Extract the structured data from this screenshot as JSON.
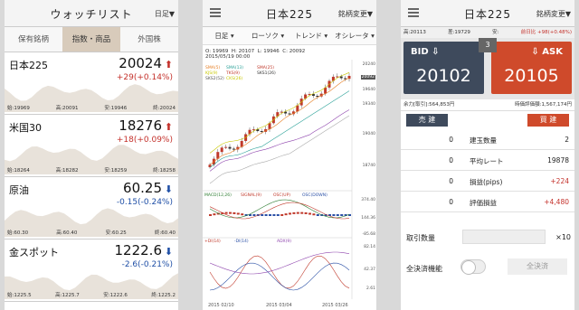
{
  "watchlist": {
    "title": "ウォッチリスト",
    "sort_label": "日足",
    "tabs": [
      "保有銘柄",
      "指数・商品",
      "外国株"
    ],
    "items": [
      {
        "name": "日本225",
        "price": "20024",
        "change": "+29(+0.14%)",
        "dir": "up",
        "open": "始:19969",
        "high": "高:20091",
        "low": "安:19946",
        "close": "終:20024"
      },
      {
        "name": "米国30",
        "price": "18276",
        "change": "+18(+0.09%)",
        "dir": "up",
        "open": "始:18264",
        "high": "高:18282",
        "low": "安:18259",
        "close": "終:18258"
      },
      {
        "name": "原油",
        "price": "60.25",
        "change": "-0.15(-0.24%)",
        "dir": "down",
        "open": "始:60.30",
        "high": "高:60.40",
        "low": "安:60.25",
        "close": "終:60.40"
      },
      {
        "name": "金スポット",
        "price": "1222.6",
        "change": "-2.6(-0.21%)",
        "dir": "down",
        "open": "始:1225.5",
        "high": "高:1225.7",
        "low": "安:1222.6",
        "close": "終:1225.2"
      }
    ]
  },
  "chart_screen": {
    "title": "日本225",
    "change_label": "銘柄変更",
    "tabs": [
      "日足",
      "ローソク",
      "トレンド",
      "オシレータ"
    ],
    "ohlc": {
      "open": "O: 19969",
      "high": "H: 20107",
      "low": "L: 19946",
      "close": "C: 20092"
    },
    "datetime": "2015/05/19 00:00",
    "legend1": [
      "SMA(5)",
      "SMA(13)",
      "SMA(25)",
      "KJS(9)",
      "TKS(9)",
      "SKS1(26)",
      "SKS2(52)",
      "CKS(26)"
    ],
    "legend2": [
      "MACD(12,26)",
      "SIGNAL(9)",
      "OSC(UP)",
      "OSC(DOWN)"
    ],
    "legend3": [
      "+DI(14)",
      "-DI(14)",
      "ADX(9)"
    ],
    "price_axis": [
      "20240",
      "20092",
      "19640",
      "19340",
      "19040",
      "18740"
    ],
    "macd_axis": [
      "374.40",
      "144.36",
      "-85.68"
    ],
    "adx_axis": [
      "82.14",
      "42.37",
      "2.61"
    ],
    "dates": [
      "2015 02/10",
      "2015 03/04",
      "2015 03/26"
    ],
    "colors": {
      "up_candle": "#c0392b",
      "down_candle": "#333333"
    }
  },
  "order": {
    "title": "日本225",
    "change_label": "銘柄変更",
    "high": "高:20113",
    "spread_info": "差:19729",
    "low": "安:",
    "change": "前日比 +98(+0.48%)",
    "bid_label": "BID",
    "ask_label": "ASK",
    "bid": "20102",
    "ask": "20105",
    "spread": "3",
    "margin": "余力[取引]:564,853円",
    "valuation": "時価評価額:1,567,174円",
    "sell_label": "売 建",
    "buy_label": "買 建",
    "rows": [
      {
        "left": "0",
        "label": "建玉数量",
        "right": "2",
        "red": false
      },
      {
        "left": "0",
        "label": "平均レート",
        "right": "19878",
        "red": false
      },
      {
        "left": "0",
        "label": "損益(pips)",
        "right": "+224",
        "red": true
      },
      {
        "left": "0",
        "label": "評価損益",
        "right": "+4,480",
        "red": true
      }
    ],
    "qty_label": "取引数量",
    "qty_unit": "×10",
    "close_all_label": "全決済機能",
    "close_all_button": "全決済"
  }
}
